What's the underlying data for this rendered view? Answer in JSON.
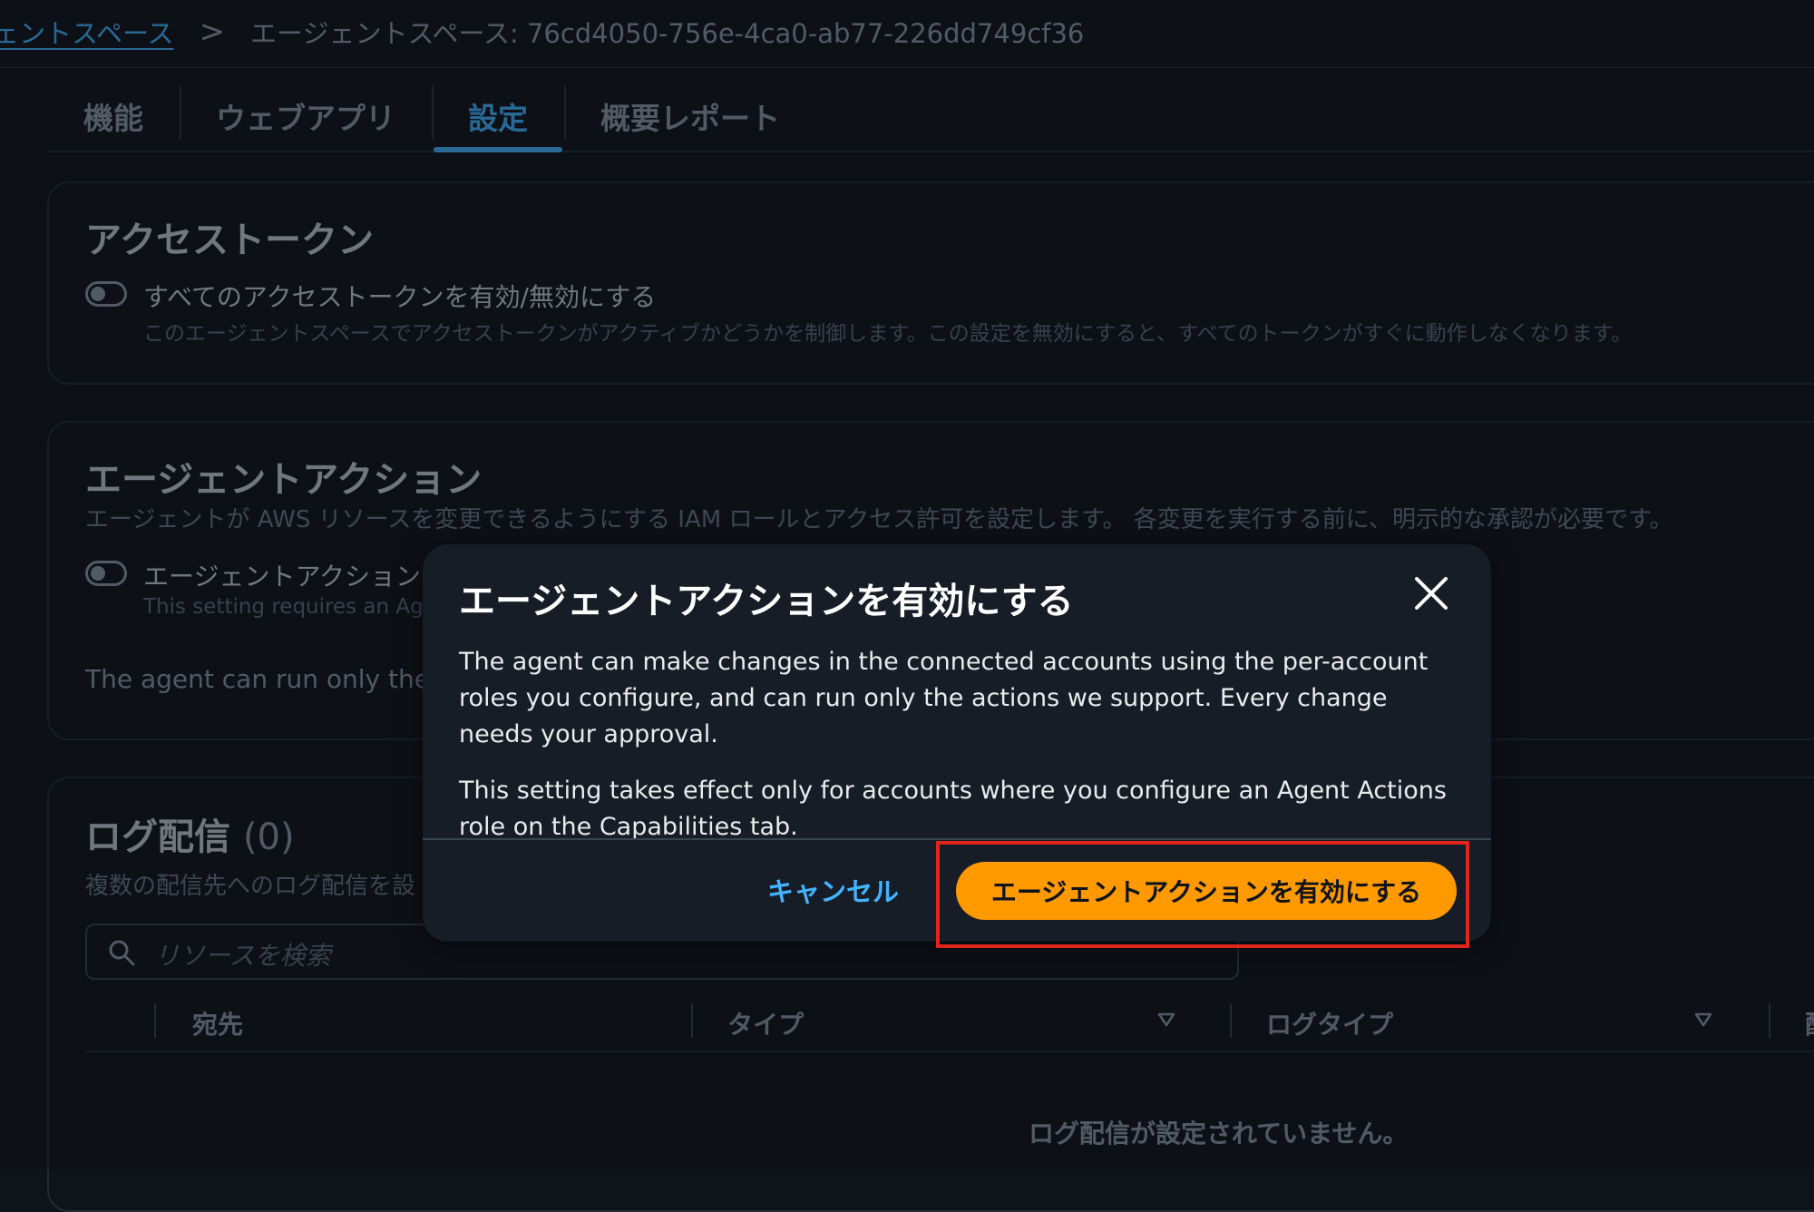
{
  "breadcrumb": {
    "parent": "ェントスペース",
    "separator": ">",
    "current": "エージェントスペース: 76cd4050-756e-4ca0-ab77-226dd749cf36"
  },
  "tabs": [
    {
      "label": "機能"
    },
    {
      "label": "ウェブアプリ"
    },
    {
      "label": "設定",
      "active": true
    },
    {
      "label": "概要レポート"
    }
  ],
  "access_tokens": {
    "title": "アクセストークン",
    "toggle_label": "すべてのアクセストークンを有効/無効にする",
    "description": "このエージェントスペースでアクセストークンがアクティブかどうかを制御します。この設定を無効にすると、すべてのトークンがすぐに動作しなくなります。"
  },
  "agent_actions": {
    "title": "エージェントアクション",
    "description": "エージェントが AWS リソースを変更できるようにする IAM ロールとアクセス許可を設定します。 各変更を実行する前に、明示的な承認が必要です。",
    "toggle_label": "エージェントアクションを",
    "toggle_hint": "This setting requires an Agen",
    "note": "The agent can run only the ac"
  },
  "log_delivery": {
    "title": "ログ配信",
    "count": "(0)",
    "description": "複数の配信先へのログ配信を設",
    "search_placeholder": "リソースを検索",
    "columns": [
      "宛先",
      "タイプ",
      "ログタイプ",
      "配"
    ],
    "empty_message": "ログ配信が設定されていません。"
  },
  "modal": {
    "title": "エージェントアクションを有効にする",
    "paragraph1": "The agent can make changes in the connected accounts using the per-account roles you configure, and can run only the actions we support. Every change needs your approval.",
    "paragraph2": "This setting takes effect only for accounts where you configure an Agent Actions role on the Capabilities tab.",
    "cancel_label": "キャンセル",
    "confirm_label": "エージェントアクションを有効にする"
  },
  "colors": {
    "accent": "#42b4ff",
    "primary_button": "#ff9900",
    "highlight": "#e0251b",
    "background": "#0f141a",
    "modal_background": "#161d26"
  },
  "icons": {
    "close": "close-icon",
    "search": "search-icon",
    "sort": "caret-down-icon",
    "breadcrumb_separator": "chevron-right-icon"
  }
}
